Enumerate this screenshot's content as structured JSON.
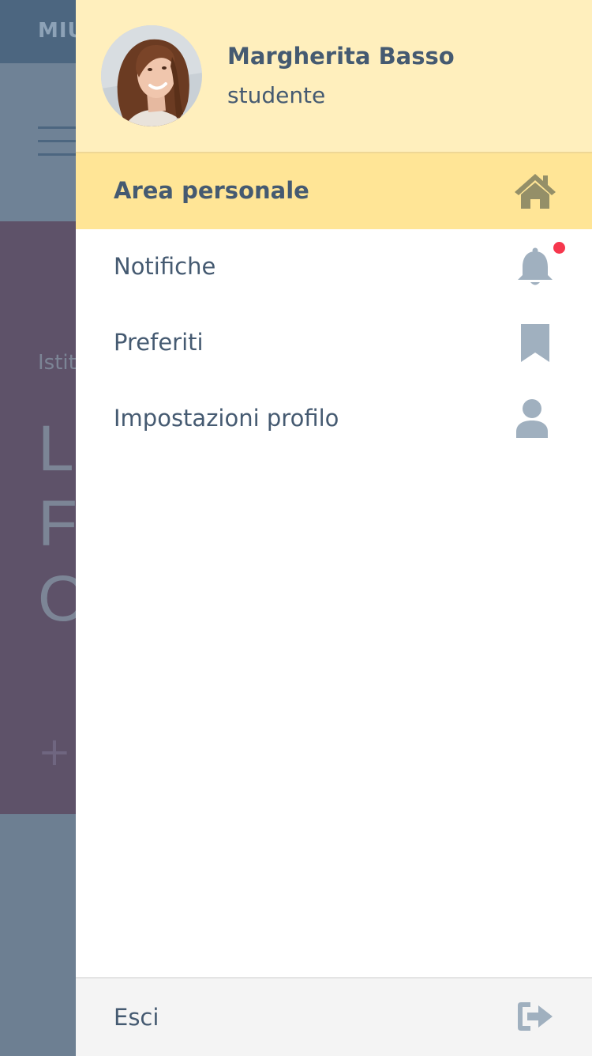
{
  "background_page": {
    "topbar_text": "MIU",
    "hero_small": "Istit",
    "hero_lines": [
      "Li",
      "Fo",
      "O"
    ],
    "hero_plus": "+"
  },
  "drawer": {
    "user": {
      "name": "Margherita Basso",
      "role": "studente"
    },
    "items": [
      {
        "label": "Area personale",
        "icon": "home-icon",
        "active": true
      },
      {
        "label": "Notifiche",
        "icon": "bell-icon",
        "has_badge": true
      },
      {
        "label": "Preferiti",
        "icon": "bookmark-icon"
      },
      {
        "label": "Impostazioni profilo",
        "icon": "user-icon"
      }
    ],
    "footer": {
      "label": "Esci",
      "icon": "logout-icon"
    }
  },
  "colors": {
    "header_bg": "#ffefbd",
    "active_bg": "#ffe596",
    "text": "#455a71",
    "icon_gray": "#a0b0bf",
    "icon_active": "#948f68",
    "badge": "#f6374d"
  }
}
